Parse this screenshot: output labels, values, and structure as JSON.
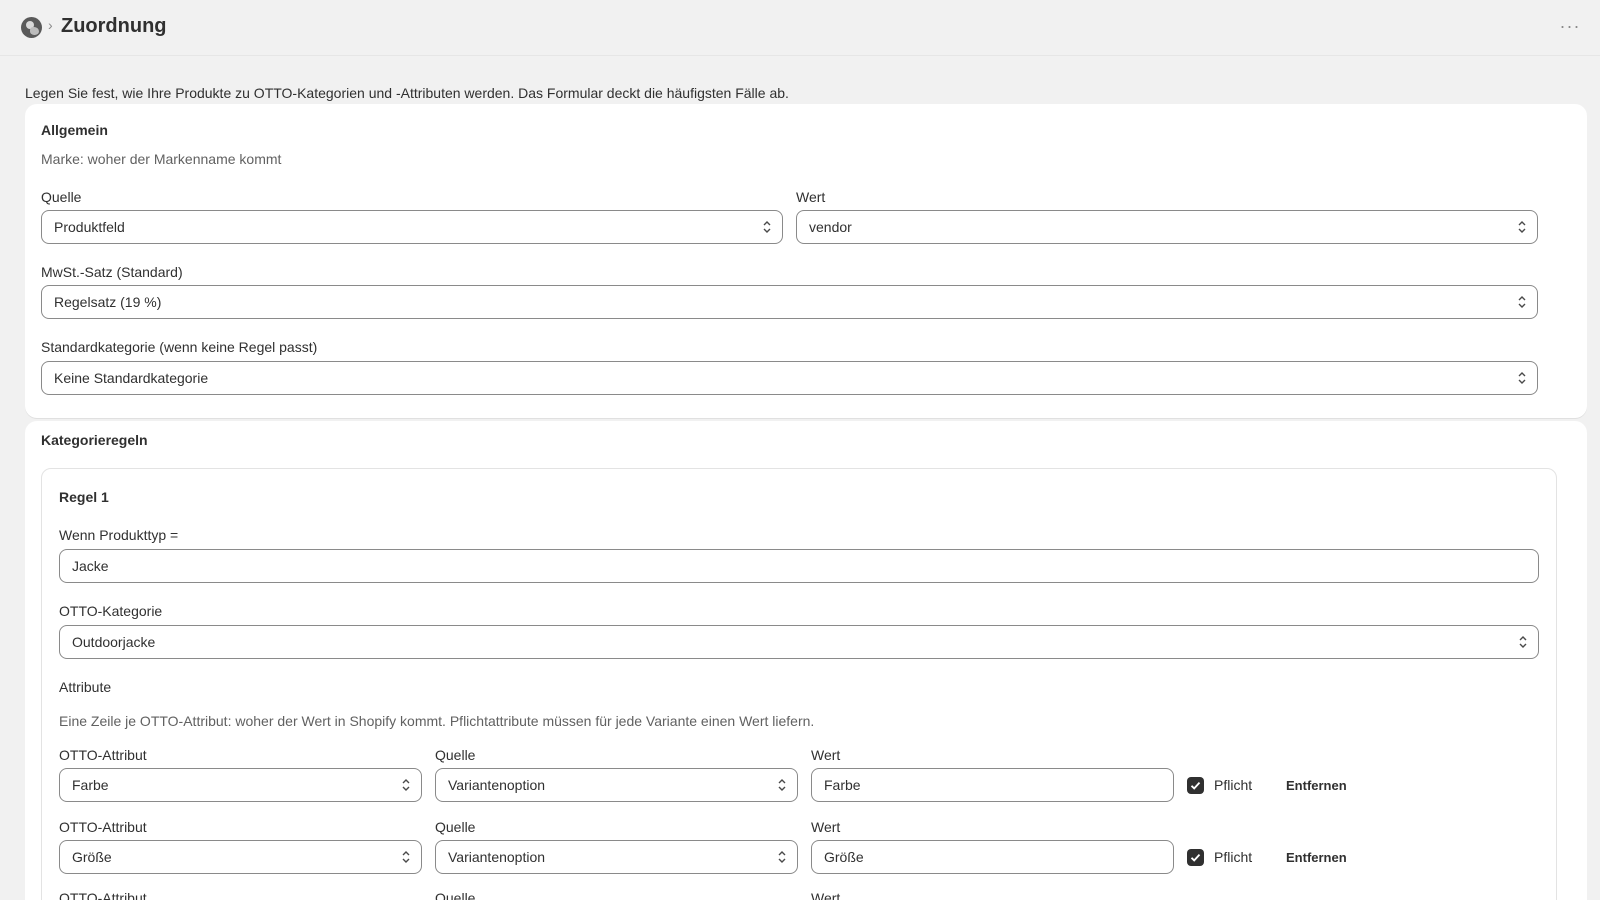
{
  "header": {
    "breadcrumb_separator": "›",
    "title": "Zuordnung",
    "more_label": "···"
  },
  "intro": "Legen Sie fest, wie Ihre Produkte zu OTTO-Kategorien und -Attributen werden. Das Formular deckt die häufigsten Fälle ab.",
  "general": {
    "heading": "Allgemein",
    "brand_hint": "Marke: woher der Markenname kommt",
    "source_label": "Quelle",
    "source_value": "Produktfeld",
    "value_label": "Wert",
    "value_value": "vendor",
    "vat_label": "MwSt.-Satz (Standard)",
    "vat_value": "Regelsatz (19 %)",
    "default_category_label": "Standardkategorie (wenn keine Regel passt)",
    "default_category_value": "Keine Standardkategorie"
  },
  "category_rules": {
    "heading": "Kategorieregeln",
    "rule": {
      "title": "Regel 1",
      "product_type_label": "Wenn Produkttyp =",
      "product_type_value": "Jacke",
      "otto_category_label": "OTTO-Kategorie",
      "otto_category_value": "Outdoorjacke",
      "attributes_heading": "Attribute",
      "attributes_hint": "Eine Zeile je OTTO-Attribut: woher der Wert in Shopify kommt. Pflichtattribute müssen für jede Variante einen Wert liefern.",
      "attribute_rows": [
        {
          "attr_label": "OTTO-Attribut",
          "attr_value": "Farbe",
          "source_label": "Quelle",
          "source_value": "Variantenoption",
          "value_label": "Wert",
          "value_value": "Farbe",
          "required_label": "Pflicht",
          "required": true,
          "remove_label": "Entfernen"
        },
        {
          "attr_label": "OTTO-Attribut",
          "attr_value": "Größe",
          "source_label": "Quelle",
          "source_value": "Variantenoption",
          "value_label": "Wert",
          "value_value": "Größe",
          "required_label": "Pflicht",
          "required": true,
          "remove_label": "Entfernen"
        },
        {
          "attr_label": "OTTO-Attribut",
          "source_label": "Quelle",
          "value_label": "Wert"
        }
      ]
    }
  }
}
